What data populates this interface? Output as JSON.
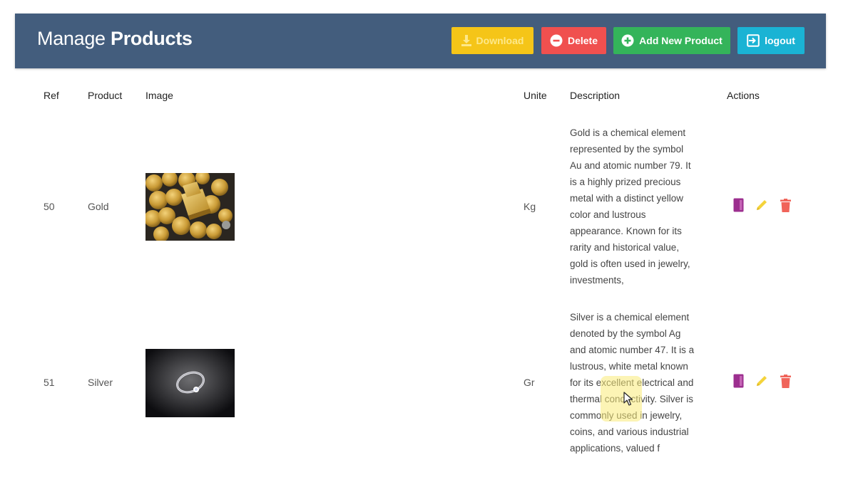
{
  "header": {
    "title_prefix": "Manage",
    "title_bold": "Products",
    "buttons": {
      "download": "Download",
      "delete": "Delete",
      "add": "Add New Product",
      "logout": "logout"
    }
  },
  "table": {
    "columns": [
      "Ref",
      "Product",
      "Image",
      "Unite",
      "Description",
      "Actions"
    ],
    "rows": [
      {
        "ref": "50",
        "product": "Gold",
        "unit": "Kg",
        "description_lines": [
          "Gold is a chemical element",
          "represented by the symbol",
          "Au and atomic number 79. It",
          "is a highly prized precious",
          "metal with a distinct yellow",
          "color and lustrous",
          "appearance. Known for its",
          "rarity and historical value,",
          "gold is often used in jewelry,",
          "investments,"
        ]
      },
      {
        "ref": "51",
        "product": "Silver",
        "unit": "Gr",
        "description_lines": [
          "Silver is a chemical element",
          "denoted by the symbol Ag",
          "and atomic number 47. It is a",
          "lustrous, white metal known",
          "for its excellent electrical and",
          "thermal conductivity. Silver is",
          "commonly used in jewelry,",
          "coins, and various industrial",
          "applications, valued f"
        ]
      }
    ]
  },
  "colors": {
    "header_bg": "#435d7d",
    "download": "#f5c518",
    "delete": "#f0504f",
    "add": "#34b45a",
    "logout": "#1ab3d4",
    "view_icon": "#9c2f8f",
    "edit_icon": "#f4d33b",
    "trash_icon": "#f0645a"
  },
  "icons": {
    "download": "download-icon",
    "delete": "minus-circle-icon",
    "add": "plus-circle-icon",
    "logout": "logout-icon",
    "view": "book-icon",
    "edit": "pencil-icon",
    "trash": "trash-icon"
  }
}
